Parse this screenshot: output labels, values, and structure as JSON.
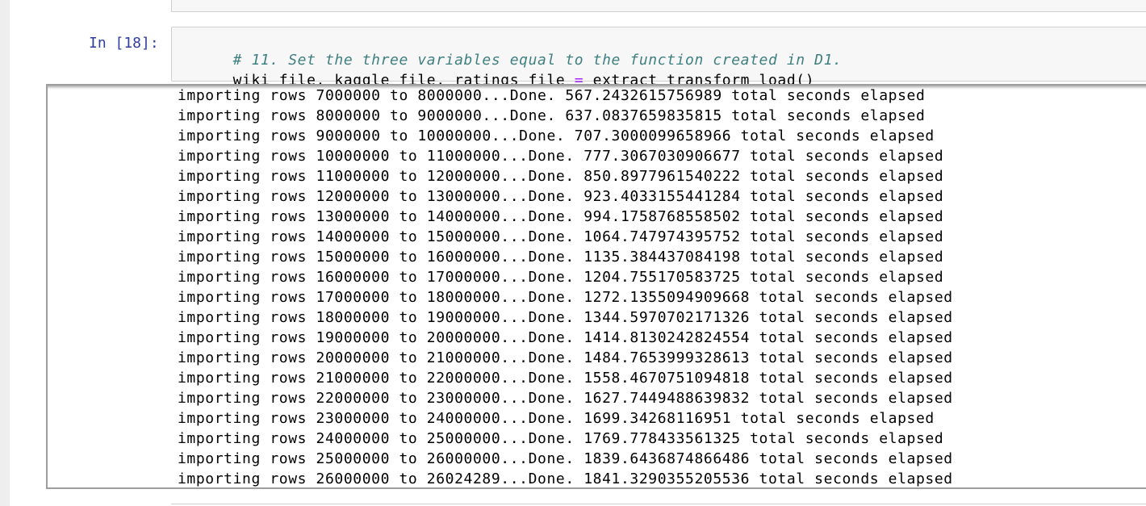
{
  "cell": {
    "prompt": "In [18]:",
    "code": {
      "comment": "# 11. Set the three variables equal to the function created in D1.",
      "line2_left": "wiki_file, kaggle_file, ratings_file ",
      "line2_op": "=",
      "line2_right": " extract_transform_load()"
    }
  },
  "output": {
    "lines": [
      "importing rows 7000000 to 8000000...Done. 567.2432615756989 total seconds elapsed",
      "importing rows 8000000 to 9000000...Done. 637.0837659835815 total seconds elapsed",
      "importing rows 9000000 to 10000000...Done. 707.3000099658966 total seconds elapsed",
      "importing rows 10000000 to 11000000...Done. 777.3067030906677 total seconds elapsed",
      "importing rows 11000000 to 12000000...Done. 850.8977961540222 total seconds elapsed",
      "importing rows 12000000 to 13000000...Done. 923.4033155441284 total seconds elapsed",
      "importing rows 13000000 to 14000000...Done. 994.1758768558502 total seconds elapsed",
      "importing rows 14000000 to 15000000...Done. 1064.747974395752 total seconds elapsed",
      "importing rows 15000000 to 16000000...Done. 1135.384437084198 total seconds elapsed",
      "importing rows 16000000 to 17000000...Done. 1204.755170583725 total seconds elapsed",
      "importing rows 17000000 to 18000000...Done. 1272.1355094909668 total seconds elapsed",
      "importing rows 18000000 to 19000000...Done. 1344.5970702171326 total seconds elapsed",
      "importing rows 19000000 to 20000000...Done. 1414.8130242824554 total seconds elapsed",
      "importing rows 20000000 to 21000000...Done. 1484.7653999328613 total seconds elapsed",
      "importing rows 21000000 to 22000000...Done. 1558.4670751094818 total seconds elapsed",
      "importing rows 22000000 to 23000000...Done. 1627.7449488639832 total seconds elapsed",
      "importing rows 23000000 to 24000000...Done. 1699.34268116951 total seconds elapsed",
      "importing rows 24000000 to 25000000...Done. 1769.778433561325 total seconds elapsed",
      "importing rows 25000000 to 26000000...Done. 1839.6436874866486 total seconds elapsed",
      "importing rows 26000000 to 26024289...Done. 1841.3290355205536 total seconds elapsed"
    ]
  },
  "colors": {
    "prompt": "#303f9f",
    "comment": "#408080",
    "operator": "#aa22ff",
    "cell_background": "#f7f7f7",
    "cell_border": "#cfcfcf"
  }
}
